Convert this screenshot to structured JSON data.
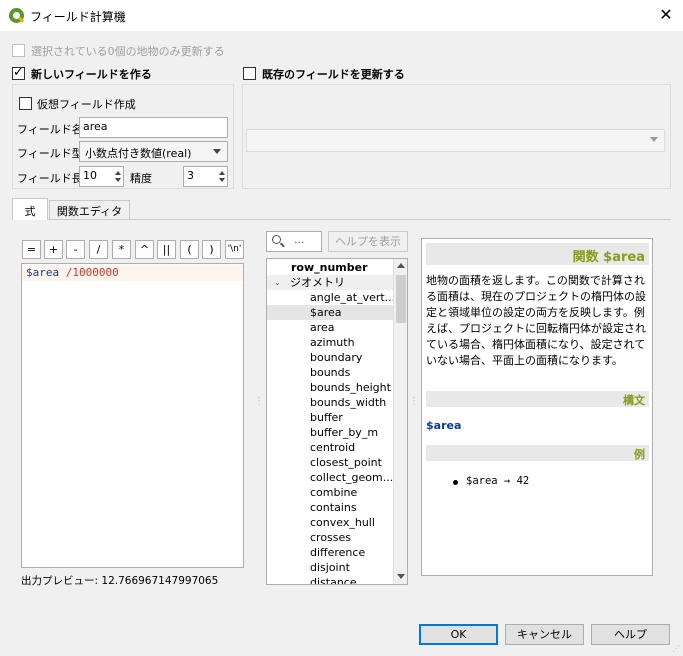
{
  "window": {
    "title": "フィールド計算機",
    "close_symbol": "✕"
  },
  "options": {
    "only_selected_label": "選択されている0個の地物のみ更新する",
    "new_field_label": "新しいフィールドを作る",
    "update_existing_label": "既存のフィールドを更新する",
    "virtual_field_label": "仮想フィールド作成"
  },
  "new_field": {
    "name_label": "フィールド名",
    "name_value": "area",
    "type_label": "フィールド型",
    "type_value": "小数点付き数値(real)",
    "length_label": "フィールド長",
    "length_value": "10",
    "precision_label": "精度",
    "precision_value": "3"
  },
  "tabs": [
    {
      "label": "式"
    },
    {
      "label": "関数エディタ"
    }
  ],
  "operators": [
    "=",
    "+",
    "-",
    "/",
    "*",
    "^",
    "||",
    "(",
    ")",
    "'\\n'"
  ],
  "expression": {
    "field": "$area",
    "rest": " /1000000"
  },
  "preview": {
    "label": "出力プレビュー:",
    "value": "12.766967147997065"
  },
  "function_search": {
    "placeholder": "...",
    "help_button": "ヘルプを表示"
  },
  "function_list": {
    "items": [
      {
        "label": "row_number"
      },
      {
        "label": "ジオメトリ"
      },
      {
        "label": "angle_at_vert..."
      },
      {
        "label": "$area"
      },
      {
        "label": "area"
      },
      {
        "label": "azimuth"
      },
      {
        "label": "boundary"
      },
      {
        "label": "bounds"
      },
      {
        "label": "bounds_height"
      },
      {
        "label": "bounds_width"
      },
      {
        "label": "buffer"
      },
      {
        "label": "buffer_by_m"
      },
      {
        "label": "centroid"
      },
      {
        "label": "closest_point"
      },
      {
        "label": "collect_geom..."
      },
      {
        "label": "combine"
      },
      {
        "label": "contains"
      },
      {
        "label": "convex_hull"
      },
      {
        "label": "crosses"
      },
      {
        "label": "difference"
      },
      {
        "label": "disjoint"
      },
      {
        "label": "distance"
      }
    ]
  },
  "help": {
    "title": "関数 $area",
    "description": "地物の面積を返します。この関数で計算される面積は、現在のプロジェクトの楕円体の設定と領域単位の設定の両方を反映します。例えば、プロジェクトに回転楕円体が設定されている場合、楕円体面積になり、設定されていない場合、平面上の面積になります。",
    "syntax_header": "構文",
    "syntax": "$area",
    "examples_header": "例",
    "example": "$area → 42"
  },
  "buttons": {
    "ok": "OK",
    "cancel": "キャンセル",
    "help": "ヘルプ"
  },
  "colors": {
    "accent_olive": "#8a9a19",
    "field_blue": "#0a3c96",
    "operator_red": "#c0392b",
    "qgis_green": "#589632"
  }
}
